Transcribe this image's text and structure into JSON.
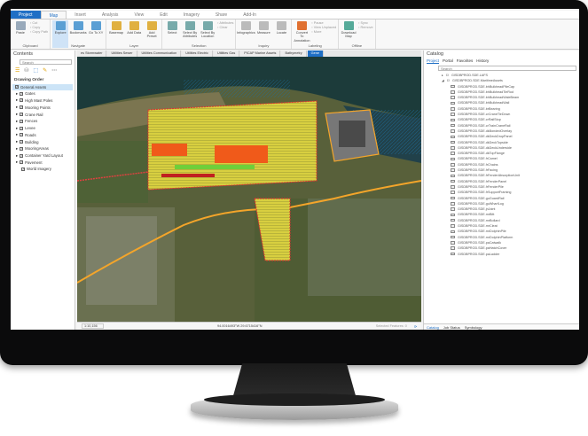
{
  "ribbon": {
    "tabs": [
      "Project",
      "Map",
      "Insert",
      "Analysis",
      "View",
      "Edit",
      "Imagery",
      "Share",
      "Add-In"
    ],
    "groups": [
      {
        "label": "Clipboard",
        "buttons": [
          "Paste"
        ],
        "small": [
          "Cut",
          "Copy",
          "Copy Path"
        ]
      },
      {
        "label": "Navigate",
        "buttons": [
          "Explore",
          "Bookmarks",
          "Go To XY"
        ]
      },
      {
        "label": "Layer",
        "buttons": [
          "Basemap",
          "Add Data",
          "Add Preset"
        ]
      },
      {
        "label": "Selection",
        "buttons": [
          "Select",
          "Select By Attributes",
          "Select By Location"
        ],
        "small": [
          "Attributes",
          "Clear"
        ]
      },
      {
        "label": "Inquiry",
        "buttons": [
          "Infographics",
          "Measure",
          "Locate"
        ]
      },
      {
        "label": "Labeling",
        "small": [
          "Pause",
          "View Unplaced",
          "More"
        ],
        "buttons": [
          "Convert To Annotation"
        ]
      },
      {
        "label": "Offline",
        "buttons": [
          "Download Map"
        ],
        "small": [
          "Sync",
          "Remove"
        ]
      }
    ]
  },
  "contents": {
    "title": "Contents",
    "search_placeholder": "Search",
    "drawing_order": "Drawing Order",
    "layers": [
      "General Assets",
      "Gates",
      "High Mast Poles",
      "Mooring Points",
      "Crane Rail",
      "Fences",
      "Levee",
      "Roads",
      "Building",
      "MooringAreas",
      "Container Yard Layout",
      "Pavement",
      "World Imagery"
    ]
  },
  "map": {
    "layer_tabs": [
      "es Stormwater",
      "Utilities Sewer",
      "Utilities Communication",
      "Utilities Electric",
      "Utilities Gas",
      "PICAP Marine Assets",
      "Bathymetry",
      "Gene"
    ],
    "scale": "1:10,156",
    "coordinates": "94.0016493°W 29.6715416°N",
    "selected_features": "Selected Features: 0"
  },
  "catalog": {
    "title": "Catalog",
    "tabs": [
      "Project",
      "Portal",
      "Favorites",
      "History"
    ],
    "search_placeholder": "Search",
    "top": [
      "GISDBPROD.SDE.LAFS",
      "GISDBPROD.SDE.MaritimeAssets"
    ],
    "items": [
      "GISDBPROD.SDE.bhBulkheadPileCap",
      "GISDBPROD.SDE.bhBulkheadTieRod",
      "GISDBPROD.SDE.bhBulkheadWaleBeam",
      "GISDBPROD.SDE.bhBulkheadWall",
      "GISDBPROD.SDE.brBearing",
      "GISDBPROD.SDE.crCraneTieDown",
      "GISDBPROD.SDE.crRailStop",
      "GISDBPROD.SDE.crTrainCraneRail",
      "GISDBPROD.SDE.dkBondedOverlay",
      "GISDBPROD.SDE.dkDeckDropPanel",
      "GISDBPROD.SDE.dkDeckTopside",
      "GISDBPROD.SDE.dkDeckUnderside",
      "GISDBPROD.SDE.dkTopFlange",
      "GISDBPROD.SDE.frCamel",
      "GISDBPROD.SDE.frChains",
      "GISDBPROD.SDE.frFacing",
      "GISDBPROD.SDE.frFenderAbsorptionUnit",
      "GISDBPROD.SDE.frFenderPanel",
      "GISDBPROD.SDE.frFenderPile",
      "GISDBPROD.SDE.frSupportFraming",
      "GISDBPROD.SDE.guGuardRail",
      "GISDBPROD.SDE.guWharfLog",
      "GISDBPROD.SDE.jnJoint",
      "GISDBPROD.SDE.mrBitt",
      "GISDBPROD.SDE.mrBollard",
      "GISDBPROD.SDE.mrCleat",
      "GISDBPROD.SDE.mrDolphinPile",
      "GISDBPROD.SDE.mrDolphinPlatform",
      "GISDBPROD.SDE.paCatwalk",
      "GISDBPROD.SDE.paHatchCover",
      "GISDBPROD.SDE.paLadder"
    ],
    "bottom_tabs": [
      "Catalog",
      "Job Status",
      "Symbology"
    ]
  },
  "colors": {
    "accent": "#1f6fc5",
    "yard": "#e8e04a",
    "building": "#f05a1a",
    "route": "#f4a52a"
  }
}
